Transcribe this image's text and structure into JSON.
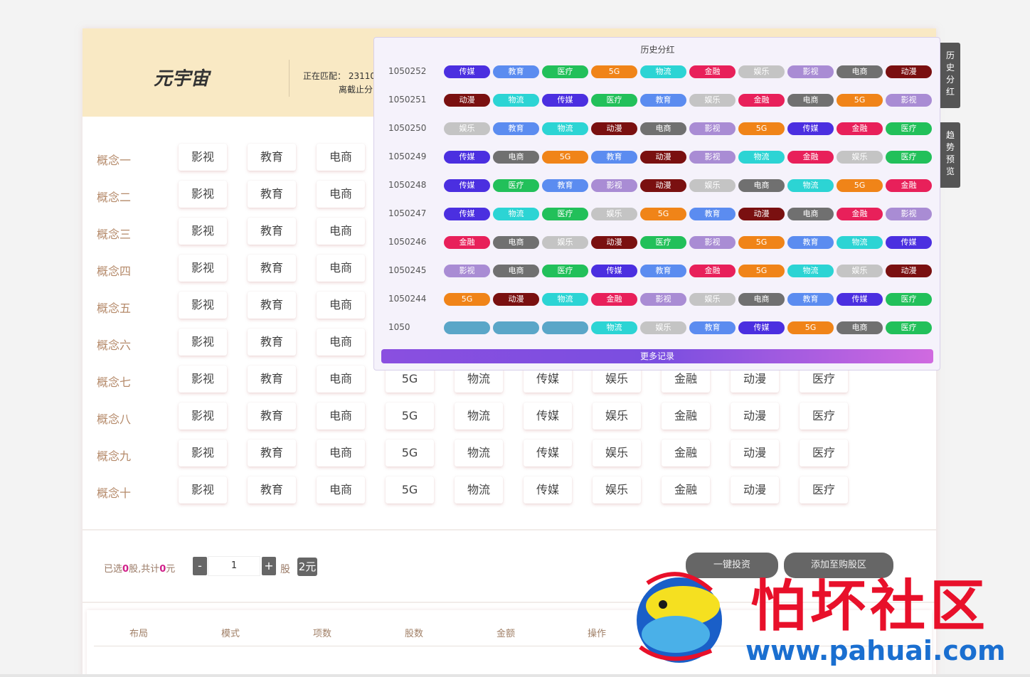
{
  "header": {
    "app_title": "元宇宙",
    "matching_text": "正在匹配：  23110",
    "deadline_text": "离截止分"
  },
  "concepts": [
    {
      "label": "概念一",
      "items": [
        "影视",
        "教育",
        "电商"
      ]
    },
    {
      "label": "概念二",
      "items": [
        "影视",
        "教育",
        "电商"
      ]
    },
    {
      "label": "概念三",
      "items": [
        "影视",
        "教育",
        "电商"
      ]
    },
    {
      "label": "概念四",
      "items": [
        "影视",
        "教育",
        "电商"
      ]
    },
    {
      "label": "概念五",
      "items": [
        "影视",
        "教育",
        "电商"
      ]
    },
    {
      "label": "概念六",
      "items": [
        "影视",
        "教育",
        "电商"
      ]
    },
    {
      "label": "概念七",
      "items": [
        "影视",
        "教育",
        "电商",
        "5G",
        "物流",
        "传媒",
        "娱乐",
        "金融",
        "动漫",
        "医疗"
      ]
    },
    {
      "label": "概念八",
      "items": [
        "影视",
        "教育",
        "电商",
        "5G",
        "物流",
        "传媒",
        "娱乐",
        "金融",
        "动漫",
        "医疗"
      ]
    },
    {
      "label": "概念九",
      "items": [
        "影视",
        "教育",
        "电商",
        "5G",
        "物流",
        "传媒",
        "娱乐",
        "金融",
        "动漫",
        "医疗"
      ]
    },
    {
      "label": "概念十",
      "items": [
        "影视",
        "教育",
        "电商",
        "5G",
        "物流",
        "传媒",
        "娱乐",
        "金融",
        "动漫",
        "医疗"
      ]
    }
  ],
  "order": {
    "summary_prefix": "已选",
    "selected_count": "0",
    "summary_mid": "股,共计",
    "total_amount": "0",
    "summary_suffix": "元",
    "minus_label": "-",
    "quantity": "1",
    "plus_label": "+",
    "unit_label": "股",
    "price_badge": "2元",
    "invest_button": "一键投资",
    "add_button": "添加至购股区"
  },
  "table": {
    "columns": [
      "布局",
      "模式",
      "项数",
      "股数",
      "金额",
      "操作"
    ]
  },
  "history_popup": {
    "title": "历史分红",
    "more_button": "更多记录",
    "rows": [
      {
        "id": "1050252",
        "tags": [
          "传媒",
          "教育",
          "医疗",
          "5G",
          "物流",
          "金融",
          "娱乐",
          "影视",
          "电商",
          "动漫"
        ]
      },
      {
        "id": "1050251",
        "tags": [
          "动漫",
          "物流",
          "传媒",
          "医疗",
          "教育",
          "娱乐",
          "金融",
          "电商",
          "5G",
          "影视"
        ]
      },
      {
        "id": "1050250",
        "tags": [
          "娱乐",
          "教育",
          "物流",
          "动漫",
          "电商",
          "影视",
          "5G",
          "传媒",
          "金融",
          "医疗"
        ]
      },
      {
        "id": "1050249",
        "tags": [
          "传媒",
          "电商",
          "5G",
          "教育",
          "动漫",
          "影视",
          "物流",
          "金融",
          "娱乐",
          "医疗"
        ]
      },
      {
        "id": "1050248",
        "tags": [
          "传媒",
          "医疗",
          "教育",
          "影视",
          "动漫",
          "娱乐",
          "电商",
          "物流",
          "5G",
          "金融"
        ]
      },
      {
        "id": "1050247",
        "tags": [
          "传媒",
          "物流",
          "医疗",
          "娱乐",
          "5G",
          "教育",
          "动漫",
          "电商",
          "金融",
          "影视"
        ]
      },
      {
        "id": "1050246",
        "tags": [
          "金融",
          "电商",
          "娱乐",
          "动漫",
          "医疗",
          "影视",
          "5G",
          "教育",
          "物流",
          "传媒"
        ]
      },
      {
        "id": "1050245",
        "tags": [
          "影视",
          "电商",
          "医疗",
          "传媒",
          "教育",
          "金融",
          "5G",
          "物流",
          "娱乐",
          "动漫"
        ]
      },
      {
        "id": "1050244",
        "tags": [
          "5G",
          "动漫",
          "物流",
          "金融",
          "影视",
          "娱乐",
          "电商",
          "教育",
          "传媒",
          "医疗"
        ]
      },
      {
        "id": "1050",
        "tags": [
          "",
          "",
          "",
          "物流",
          "娱乐",
          "教育",
          "传媒",
          "5G",
          "电商",
          "医疗"
        ]
      }
    ]
  },
  "tag_colors": {
    "传媒": "#4b2fe0",
    "教育": "#5b8cf0",
    "医疗": "#22c05a",
    "5G": "#f08418",
    "物流": "#2cd4d4",
    "金融": "#e8205a",
    "娱乐": "#c4c4c4",
    "影视": "#a98cd4",
    "电商": "#707070",
    "动漫": "#7a1010",
    "": "#5aa6c8"
  },
  "side_tabs": {
    "history": "历史分红",
    "trend": "趋势预览"
  },
  "watermark": {
    "title": "怕坏社区",
    "url": "www.pahuai.com"
  }
}
